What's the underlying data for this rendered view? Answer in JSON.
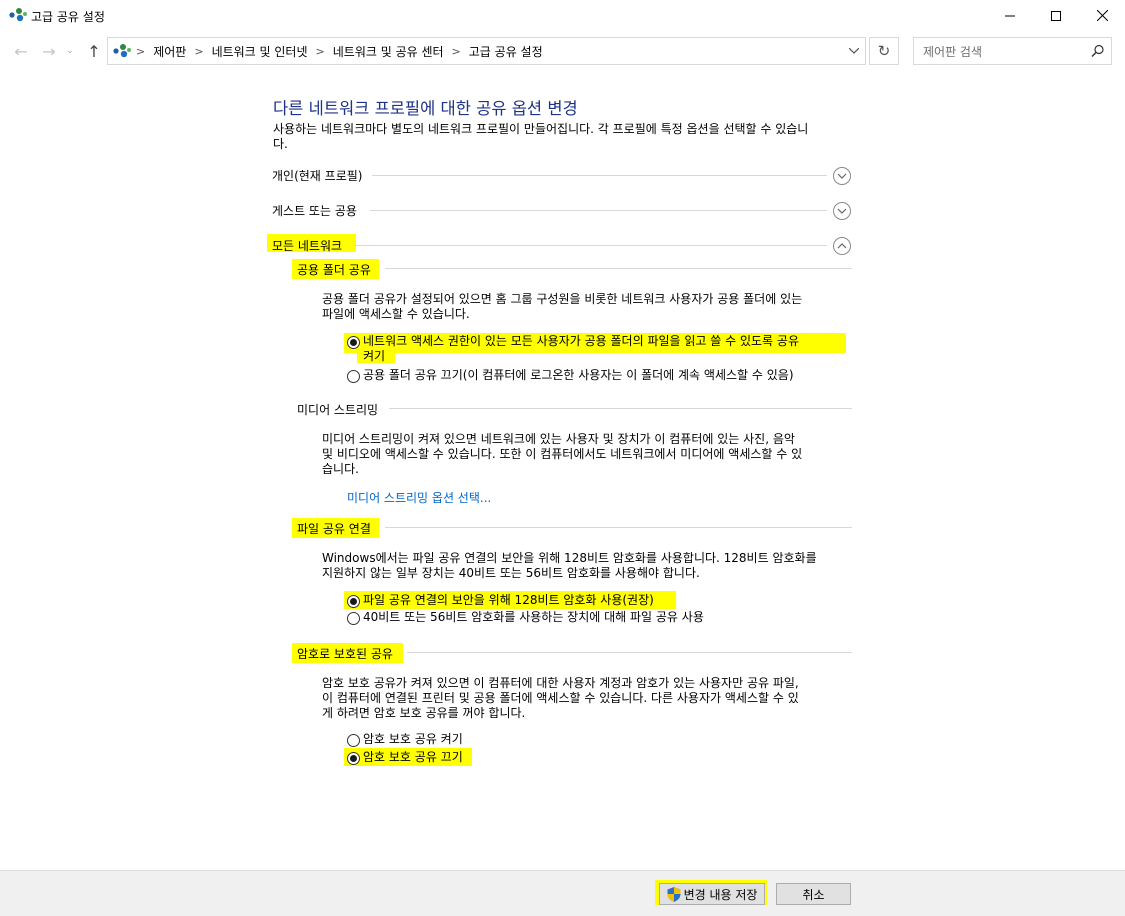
{
  "window": {
    "title": "고급 공유 설정",
    "minimize_icon": "minimize-icon",
    "maximize_icon": "maximize-icon",
    "close_icon": "close-icon"
  },
  "nav": {
    "back_icon": "back-arrow-icon",
    "forward_icon": "forward-arrow-icon",
    "recent_icon": "chevron-down-icon",
    "up_icon": "up-arrow-icon",
    "breadcrumbs": [
      "제어판",
      "네트워크 및 인터넷",
      "네트워크 및 공유 센터",
      "고급 공유 설정"
    ],
    "refresh_icon": "refresh-icon",
    "search_placeholder": "제어판 검색"
  },
  "content": {
    "heading": "다른 네트워크 프로필에 대한 공유 옵션 변경",
    "intro_line1": "사용하는 네트워크마다 별도의 네트워크 프로필이 만들어집니다. 각 프로필에 특정 옵션을 선택할 수 있습니",
    "intro_line2": "다.",
    "profiles": [
      {
        "label": "개인(현재 프로필)",
        "state": "collapsed"
      },
      {
        "label": "게스트 또는 공용",
        "state": "collapsed"
      },
      {
        "label": "모든 네트워크",
        "state": "expanded"
      }
    ],
    "public_folder": {
      "title": "공용 폴더 공유",
      "desc1": "공용 폴더 공유가 설정되어 있으면 홈 그룹 구성원을 비롯한 네트워크 사용자가 공용 폴더에 있는",
      "desc2": "파일에 액세스할 수 있습니다.",
      "option_on_line1": "네트워크 액세스 권한이 있는 모든 사용자가 공용 폴더의 파일을 읽고 쓸 수 있도록 공유",
      "option_on_line2": "켜기",
      "option_off": "공용 폴더 공유 끄기(이 컴퓨터에 로그온한 사용자는 이 폴더에 계속 액세스할 수 있음)",
      "selected": "on"
    },
    "media": {
      "title": "미디어 스트리밍",
      "desc1": "미디어 스트리밍이 켜져 있으면 네트워크에 있는 사용자 및 장치가 이 컴퓨터에 있는 사진, 음악",
      "desc2": "및 비디오에 액세스할 수 있습니다. 또한 이 컴퓨터에서도 네트워크에서 미디어에 액세스할 수 있",
      "desc3": "습니다.",
      "link": "미디어 스트리밍 옵션 선택..."
    },
    "file_sharing": {
      "title": "파일 공유 연결",
      "desc1": "Windows에서는 파일 공유 연결의 보안을 위해 128비트 암호화를 사용합니다. 128비트 암호화를",
      "desc2": "지원하지 않는 일부 장치는 40비트 또는 56비트 암호화를 사용해야 합니다.",
      "option_128": "파일 공유 연결의 보안을 위해 128비트 암호화 사용(권장)",
      "option_40_56": "40비트 또는 56비트 암호화를 사용하는 장치에 대해 파일 공유 사용",
      "selected": "128"
    },
    "password": {
      "title": "암호로 보호된 공유",
      "desc1": "암호 보호 공유가 켜져 있으면 이 컴퓨터에 대한 사용자 계정과 암호가 있는 사용자만 공유 파일,",
      "desc2": "이 컴퓨터에 연결된 프린터 및 공용 폴더에 액세스할 수 있습니다. 다른 사용자가 액세스할 수 있",
      "desc3": "게 하려면 암호 보호 공유를 꺼야 합니다.",
      "option_on": "암호 보호 공유 켜기",
      "option_off": "암호 보호 공유 끄기",
      "selected": "off"
    }
  },
  "footer": {
    "save_label": "변경 내용 저장",
    "save_icon": "uac-shield-icon",
    "cancel_label": "취소"
  },
  "colors": {
    "heading": "#1e3287",
    "link": "#0066cc",
    "highlight": "#ffff00"
  }
}
